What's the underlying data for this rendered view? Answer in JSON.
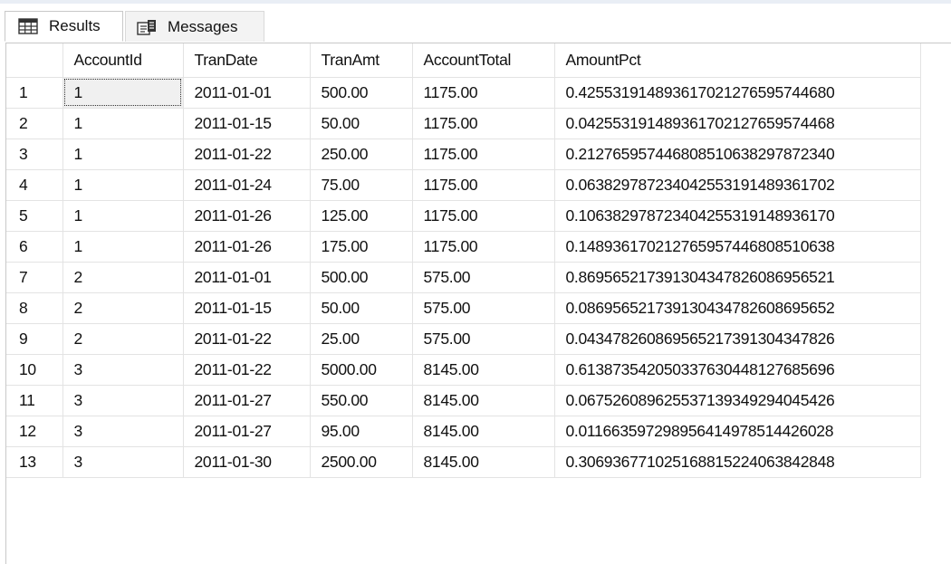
{
  "tabs": {
    "results": {
      "label": "Results",
      "icon": "grid-icon"
    },
    "messages": {
      "label": "Messages",
      "icon": "messages-icon"
    }
  },
  "grid": {
    "columns": [
      "",
      "AccountId",
      "TranDate",
      "TranAmt",
      "AccountTotal",
      "AmountPct"
    ],
    "rows": [
      [
        "1",
        "1",
        "2011-01-01",
        "500.00",
        "1175.00",
        "0.425531914893617021276595744680"
      ],
      [
        "2",
        "1",
        "2011-01-15",
        "50.00",
        "1175.00",
        "0.042553191489361702127659574468"
      ],
      [
        "3",
        "1",
        "2011-01-22",
        "250.00",
        "1175.00",
        "0.212765957446808510638297872340"
      ],
      [
        "4",
        "1",
        "2011-01-24",
        "75.00",
        "1175.00",
        "0.063829787234042553191489361702"
      ],
      [
        "5",
        "1",
        "2011-01-26",
        "125.00",
        "1175.00",
        "0.106382978723404255319148936170"
      ],
      [
        "6",
        "1",
        "2011-01-26",
        "175.00",
        "1175.00",
        "0.148936170212765957446808510638"
      ],
      [
        "7",
        "2",
        "2011-01-01",
        "500.00",
        "575.00",
        "0.869565217391304347826086956521"
      ],
      [
        "8",
        "2",
        "2011-01-15",
        "50.00",
        "575.00",
        "0.086956521739130434782608695652"
      ],
      [
        "9",
        "2",
        "2011-01-22",
        "25.00",
        "575.00",
        "0.043478260869565217391304347826"
      ],
      [
        "10",
        "3",
        "2011-01-22",
        "5000.00",
        "8145.00",
        "0.613873542050337630448127685696"
      ],
      [
        "11",
        "3",
        "2011-01-27",
        "550.00",
        "8145.00",
        "0.067526089625537139349294045426"
      ],
      [
        "12",
        "3",
        "2011-01-27",
        "95.00",
        "8145.00",
        "0.011663597298956414978514426028"
      ],
      [
        "13",
        "3",
        "2011-01-30",
        "2500.00",
        "8145.00",
        "0.306936771025168815224063842848"
      ]
    ]
  }
}
